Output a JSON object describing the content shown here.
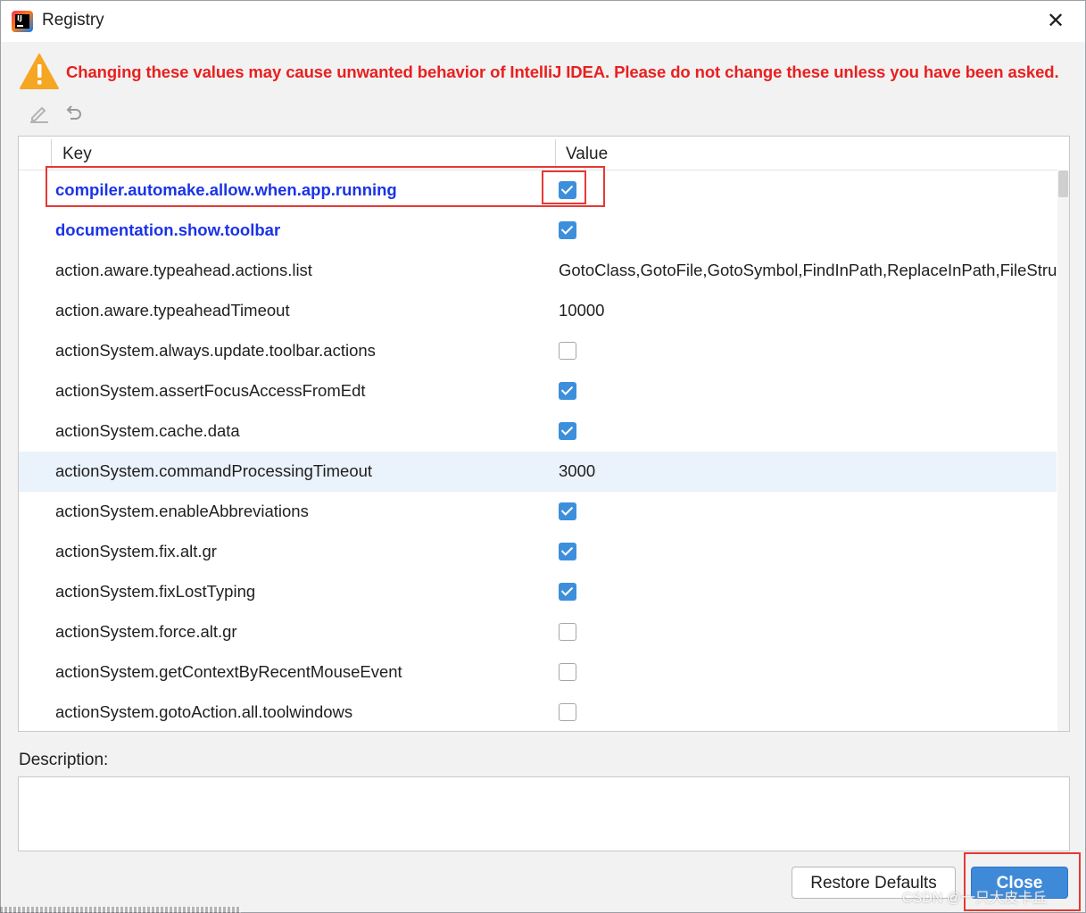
{
  "window": {
    "title": "Registry",
    "close_glyph": "✕"
  },
  "warning": {
    "icon": "warning-triangle-icon",
    "text": "Changing these values may cause unwanted behavior of IntelliJ IDEA. Please do not change these unless you have been asked."
  },
  "toolbar": {
    "edit_icon": "edit-pencil-icon",
    "revert_icon": "revert-undo-icon"
  },
  "table": {
    "columns": {
      "key": "Key",
      "value": "Value"
    },
    "rows": [
      {
        "key": "compiler.automake.allow.when.app.running",
        "type": "checkbox",
        "checked": true,
        "modified": true
      },
      {
        "key": "documentation.show.toolbar",
        "type": "checkbox",
        "checked": true,
        "modified": true
      },
      {
        "key": "action.aware.typeahead.actions.list",
        "type": "text",
        "value": "GotoClass,GotoFile,GotoSymbol,FindInPath,ReplaceInPath,FileStru",
        "modified": false
      },
      {
        "key": "action.aware.typeaheadTimeout",
        "type": "text",
        "value": "10000",
        "modified": false
      },
      {
        "key": "actionSystem.always.update.toolbar.actions",
        "type": "checkbox",
        "checked": false,
        "modified": false
      },
      {
        "key": "actionSystem.assertFocusAccessFromEdt",
        "type": "checkbox",
        "checked": true,
        "modified": false
      },
      {
        "key": "actionSystem.cache.data",
        "type": "checkbox",
        "checked": true,
        "modified": false
      },
      {
        "key": "actionSystem.commandProcessingTimeout",
        "type": "text",
        "value": "3000",
        "modified": false,
        "selected": true
      },
      {
        "key": "actionSystem.enableAbbreviations",
        "type": "checkbox",
        "checked": true,
        "modified": false
      },
      {
        "key": "actionSystem.fix.alt.gr",
        "type": "checkbox",
        "checked": true,
        "modified": false
      },
      {
        "key": "actionSystem.fixLostTyping",
        "type": "checkbox",
        "checked": true,
        "modified": false
      },
      {
        "key": "actionSystem.force.alt.gr",
        "type": "checkbox",
        "checked": false,
        "modified": false
      },
      {
        "key": "actionSystem.getContextByRecentMouseEvent",
        "type": "checkbox",
        "checked": false,
        "modified": false
      },
      {
        "key": "actionSystem.gotoAction.all.toolwindows",
        "type": "checkbox",
        "checked": false,
        "modified": false
      }
    ]
  },
  "description": {
    "label": "Description:",
    "text": ""
  },
  "buttons": {
    "restore": "Restore Defaults",
    "close": "Close"
  },
  "watermark": "CSDN @一只大皮卡丘",
  "colors": {
    "warning": "#e8201f",
    "modified_key": "#1a33e6",
    "checkbox": "#3d8fdc",
    "primary_button": "#3e8ad9",
    "annotation": "#e53935"
  }
}
